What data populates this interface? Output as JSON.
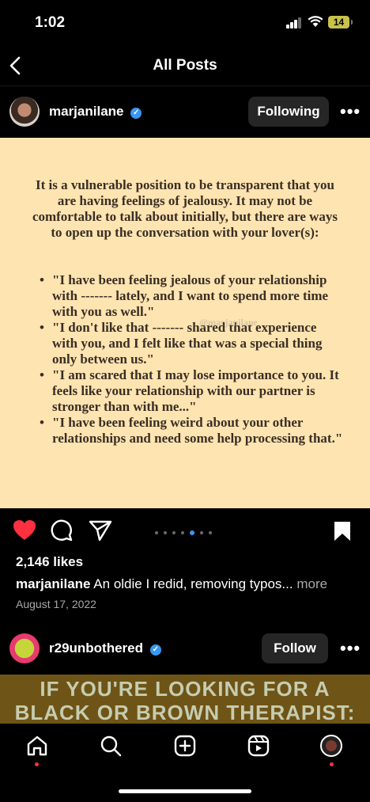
{
  "status_bar": {
    "time": "1:02",
    "battery": "14"
  },
  "nav": {
    "title": "All Posts"
  },
  "post1": {
    "username": "marjanilane",
    "follow_label": "Following",
    "image_text": {
      "intro": "It is a vulnerable position to be transparent that you are having feelings of jealousy. It may not be comfortable to talk about initially, but there are ways to open up the conversation with your lover(s):",
      "quotes": [
        "\"I have been feeling jealous of your relationship with ------- lately, and I want to spend more time with you as well.\"",
        "\"I don't like that ------- shared that experience with you, and I felt like that was a special thing only between us.\"",
        "\"I am scared that I may lose importance to you. It feels like your relationship with our partner is stronger than with me...\"",
        "\"I have been feeling weird about your other relationships and need some help processing that.\""
      ],
      "watermark": "@marjanilane"
    },
    "likes": "2,146 likes",
    "caption_user": "marjanilane",
    "caption": "An oldie I redid, removing typos...",
    "caption_more": "more",
    "date": "August 17, 2022",
    "carousel": {
      "count": 7,
      "active_index": 4
    }
  },
  "post2": {
    "username": "r29unbothered",
    "follow_label": "Follow",
    "image_text_line1": "IF YOU'RE LOOKING FOR A",
    "image_text_line2": "BLACK OR BROWN THERAPIST:"
  },
  "colors": {
    "like_red": "#ff3040",
    "verified_blue": "#3897f0",
    "post_bg": "#fde4b1",
    "post2_bg": "#6e5416"
  },
  "tabbar": {
    "icons": [
      "home-icon",
      "search-icon",
      "create-icon",
      "reels-icon",
      "profile-icon"
    ]
  }
}
